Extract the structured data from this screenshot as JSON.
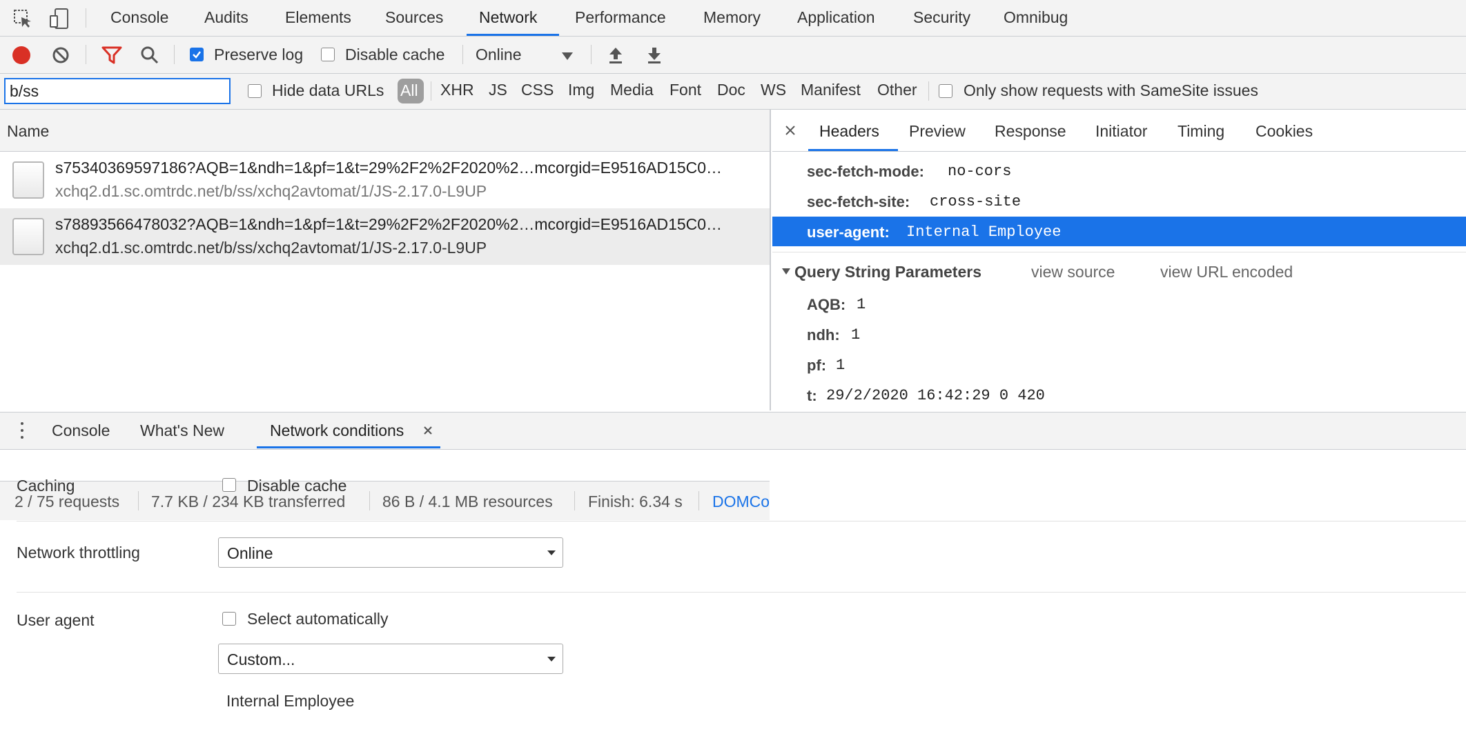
{
  "main_tabs": [
    "Console",
    "Audits",
    "Elements",
    "Sources",
    "Network",
    "Performance",
    "Memory",
    "Application",
    "Security",
    "Omnibug"
  ],
  "active_tab": "Network",
  "toolbar": {
    "preserve_log": "Preserve log",
    "disable_cache": "Disable cache",
    "throttle": "Online"
  },
  "filter": {
    "value": "b/ss",
    "hide_data_urls": "Hide data URLs",
    "types": [
      "All",
      "XHR",
      "JS",
      "CSS",
      "Img",
      "Media",
      "Font",
      "Doc",
      "WS",
      "Manifest",
      "Other"
    ],
    "samesite": "Only show requests with SameSite issues"
  },
  "requests": {
    "header": "Name",
    "rows": [
      {
        "name": "s75340369597186?AQB=1&ndh=1&pf=1&t=29%2F2%2F2020%2…mcorgid=E9516AD15C0…",
        "path": "xchq2.d1.sc.omtrdc.net/b/ss/xchq2avtomat/1/JS-2.17.0-L9UP"
      },
      {
        "name": "s78893566478032?AQB=1&ndh=1&pf=1&t=29%2F2%2F2020%2…mcorgid=E9516AD15C0…",
        "path": "xchq2.d1.sc.omtrdc.net/b/ss/xchq2avtomat/1/JS-2.17.0-L9UP"
      }
    ]
  },
  "status": {
    "requests": "2 / 75 requests",
    "transferred": "7.7 KB / 234 KB transferred",
    "resources": "86 B / 4.1 MB resources",
    "finish": "Finish: 6.34 s",
    "domc": "DOMCo"
  },
  "detail": {
    "tabs": [
      "Headers",
      "Preview",
      "Response",
      "Initiator",
      "Timing",
      "Cookies"
    ],
    "active": "Headers",
    "headers": [
      {
        "key": "sec-fetch-mode:",
        "value": "no-cors"
      },
      {
        "key": "sec-fetch-site:",
        "value": "cross-site"
      },
      {
        "key": "user-agent:",
        "value": "Internal Employee"
      }
    ],
    "qs_title": "Query String Parameters",
    "view_source": "view source",
    "view_url_encoded": "view URL encoded",
    "params": [
      {
        "key": "AQB:",
        "value": "1"
      },
      {
        "key": "ndh:",
        "value": "1"
      },
      {
        "key": "pf:",
        "value": "1"
      },
      {
        "key": "t:",
        "value": "29/2/2020 16:42:29 0 420"
      }
    ]
  },
  "drawer": {
    "tabs": [
      "Console",
      "What's New",
      "Network conditions"
    ],
    "active": "Network conditions",
    "caching_label": "Caching",
    "disable_cache": "Disable cache",
    "throttling_label": "Network throttling",
    "throttling_value": "Online",
    "ua_label": "User agent",
    "select_auto": "Select automatically",
    "ua_select": "Custom...",
    "ua_value": "Internal Employee"
  },
  "colors": {
    "accent": "#1a73e8",
    "record": "#d93025",
    "filter": "#d93025"
  }
}
